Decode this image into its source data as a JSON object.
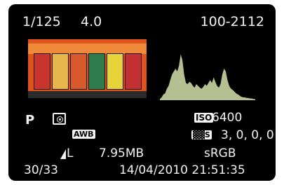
{
  "header": {
    "shutter_speed": "1/125",
    "aperture": "4.0",
    "file_number": "100-2112"
  },
  "settings": {
    "shooting_mode": "P",
    "metering_icon": "evaluative-metering-icon",
    "iso_badge": "ISO",
    "iso_value": "6400",
    "white_balance_badge": "AWB",
    "picture_style_badge": "S",
    "picture_style_values": "3,  0,  0,  0",
    "quality_label": "L",
    "file_size": "7.95MB",
    "color_space": "sRGB"
  },
  "footer": {
    "image_counter": "30/33",
    "datetime": "14/04/2010  21:51:35"
  },
  "colors": {
    "background": "#000000",
    "text": "#f2f2f2",
    "histogram_fill": "#b5bf92",
    "thumbnail_border": "#e0531d"
  },
  "thumbnail": {
    "panel_colors": [
      "#c9342c",
      "#e8b64a",
      "#d65a2c",
      "#2e7d4c",
      "#e7d43a",
      "#c42f33"
    ]
  },
  "histogram": {
    "levels": [
      0.02,
      0.05,
      0.1,
      0.12,
      0.2,
      0.25,
      0.35,
      0.45,
      0.5,
      0.55,
      0.5,
      0.6,
      0.8,
      0.7,
      0.45,
      0.3,
      0.28,
      0.32,
      0.3,
      0.25,
      0.22,
      0.28,
      0.25,
      0.22,
      0.2,
      0.23,
      0.28,
      0.25,
      0.3,
      0.35,
      0.3,
      0.4,
      0.32,
      0.25,
      0.22,
      0.28,
      0.45,
      0.55,
      0.5,
      0.35,
      0.25,
      0.2,
      0.18,
      0.15,
      0.12,
      0.1,
      0.08,
      0.06,
      0.05,
      0.05,
      0.04,
      0.04,
      0.03,
      0.03,
      0.02,
      0.02
    ]
  }
}
